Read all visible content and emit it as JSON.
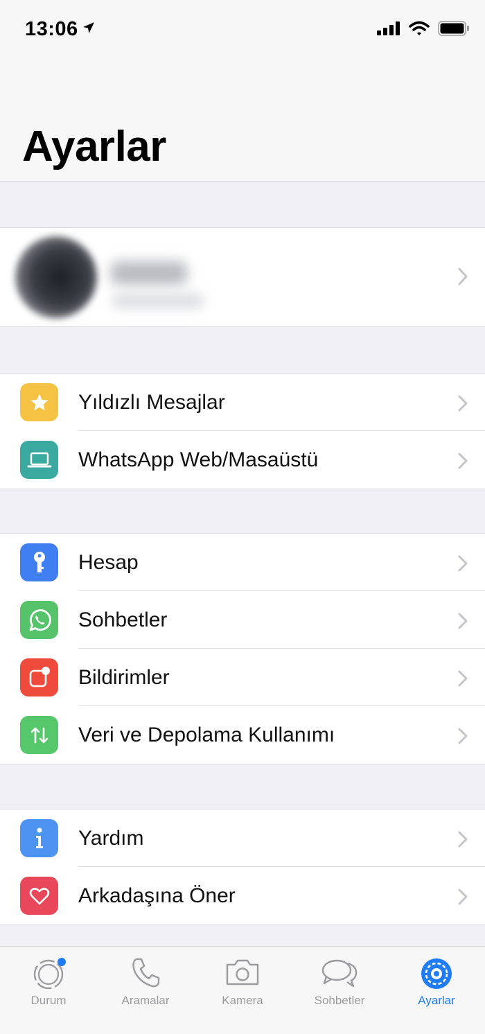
{
  "status": {
    "time": "13:06"
  },
  "header": {
    "title": "Ayarlar"
  },
  "groups": [
    {
      "items": [
        {
          "label": "Yıldızlı Mesajlar",
          "icon": "star-icon",
          "color": "#f6c243"
        },
        {
          "label": "WhatsApp Web/Masaüstü",
          "icon": "laptop-icon",
          "color": "#3aa9a0"
        }
      ]
    },
    {
      "items": [
        {
          "label": "Hesap",
          "icon": "key-icon",
          "color": "#3f7ff2"
        },
        {
          "label": "Sohbetler",
          "icon": "whatsapp-icon",
          "color": "#56c26a"
        },
        {
          "label": "Bildirimler",
          "icon": "notification-icon",
          "color": "#ef4b3c"
        },
        {
          "label": "Veri ve Depolama Kullanımı",
          "icon": "data-transfer-icon",
          "color": "#56c76a"
        }
      ]
    },
    {
      "items": [
        {
          "label": "Yardım",
          "icon": "info-icon",
          "color": "#4c93f2"
        },
        {
          "label": "Arkadaşına Öner",
          "icon": "heart-icon",
          "color": "#e9475a"
        }
      ]
    }
  ],
  "tabs": [
    {
      "label": "Durum",
      "icon": "status-icon"
    },
    {
      "label": "Aramalar",
      "icon": "phone-icon"
    },
    {
      "label": "Kamera",
      "icon": "camera-icon"
    },
    {
      "label": "Sohbetler",
      "icon": "chat-bubbles-icon"
    },
    {
      "label": "Ayarlar",
      "icon": "settings-gear-icon",
      "active": true
    }
  ],
  "colors": {
    "accent": "#1f7bf6",
    "background": "#efeff4",
    "tab_inactive": "#9b9b9f"
  }
}
